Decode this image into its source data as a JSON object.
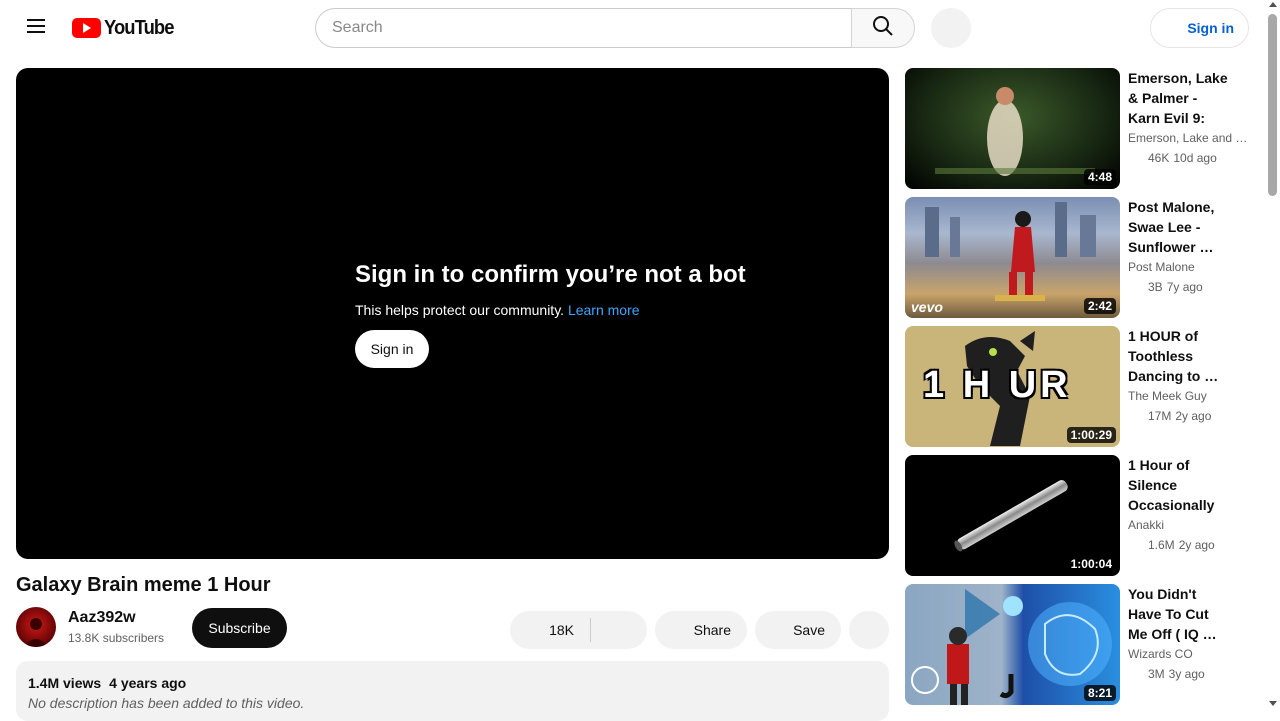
{
  "header": {
    "logo_text": "YouTube",
    "search_placeholder": "Search",
    "signin_label": "Sign in",
    "icons": [
      "menu-icon",
      "youtube-logo-icon",
      "search-icon"
    ]
  },
  "player": {
    "heading": "Sign in to confirm you’re not a bot",
    "message": "This helps protect our community.",
    "learn_more": "Learn more",
    "signin_label": "Sign in"
  },
  "video": {
    "title": "Galaxy Brain meme 1 Hour",
    "channel": "Aaz392w",
    "subscribers": "13.8K subscribers",
    "subscribe_label": "Subscribe",
    "likes": "18K",
    "share_label": "Share",
    "save_label": "Save",
    "views": "1.4M views",
    "age": "4 years ago",
    "description": "No description has been added to this video."
  },
  "recommendations": [
    {
      "title": "Emerson, Lake & Palmer - Karn Evil 9: 1…",
      "channel": "Emerson, Lake and P...",
      "views": "46K",
      "age": "10d ago",
      "duration": "4:48"
    },
    {
      "title": "Post Malone, Swae Lee - Sunflower …",
      "channel": "Post Malone",
      "views": "3B",
      "age": "7y ago",
      "duration": "2:42",
      "thumb_text": "vevo"
    },
    {
      "title": "1 HOUR of Toothless Dancing to …",
      "channel": "The Meek Guy",
      "views": "17M",
      "age": "2y ago",
      "duration": "1:00:29",
      "thumb_text": "1 H UR"
    },
    {
      "title": "1 Hour of Silence Occasionally …",
      "channel": "Anakki",
      "views": "1.6M",
      "age": "2y ago",
      "duration": "1:00:04"
    },
    {
      "title": "You Didn't Have To Cut Me Off ( IQ …",
      "channel": "Wizards CO",
      "views": "3M",
      "age": "3y ago",
      "duration": "8:21"
    }
  ],
  "colors": {
    "brand_red": "#ff0000",
    "link_blue": "#065fd4",
    "learn_more_blue": "#3ea6ff",
    "subscribe_bg": "#0f0f0f"
  }
}
